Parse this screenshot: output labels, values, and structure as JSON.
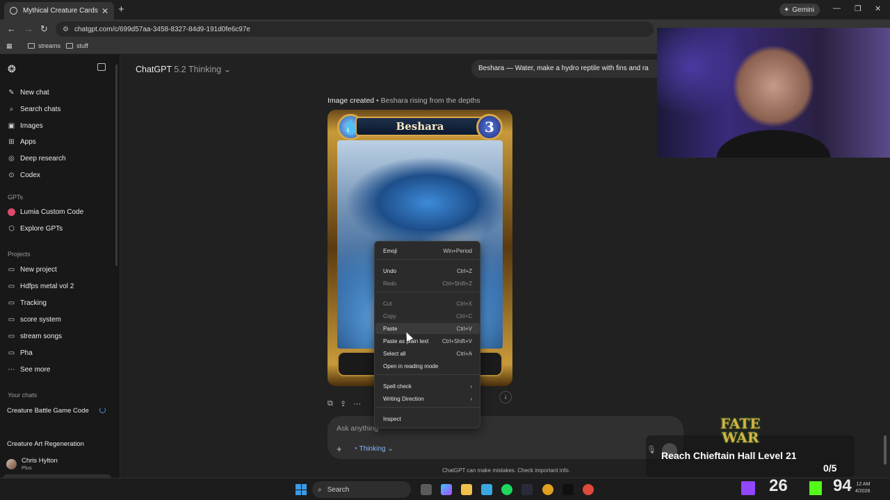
{
  "browser": {
    "tab_title": "Mythical Creature Cards",
    "url": "chatgpt.com/c/699d57aa-3458-8327-84d9-191d0fe6c97e",
    "gemini_label": "Gemini",
    "bookmarks": [
      "streams",
      "stuff"
    ]
  },
  "sidebar": {
    "nav": [
      {
        "label": "New chat",
        "icon": "edit-icon"
      },
      {
        "label": "Search chats",
        "icon": "search-icon"
      },
      {
        "label": "Images",
        "icon": "image-icon"
      },
      {
        "label": "Apps",
        "icon": "grid-icon"
      },
      {
        "label": "Deep research",
        "icon": "telescope-icon"
      },
      {
        "label": "Codex",
        "icon": "code-icon"
      }
    ],
    "gpts_heading": "GPTs",
    "gpts": [
      {
        "label": "Lumia Custom Code"
      },
      {
        "label": "Explore GPTs"
      }
    ],
    "projects_heading": "Projects",
    "projects": [
      "New project",
      "Hdfps metal vol 2",
      "Tracking",
      "score system",
      "stream songs",
      "Pha",
      "See more"
    ],
    "chats_heading": "Your chats",
    "chats": [
      "Creature Battle Game Code",
      "Mythical Creature Cards",
      "Creature Art Regeneration"
    ],
    "user": {
      "name": "Chris Hylton",
      "plan": "Plus"
    }
  },
  "main": {
    "model_name": "ChatGPT",
    "model_version": "5.2 Thinking",
    "user_message": "Beshara — Water, make a hydro reptile with fins and ra",
    "image_caption_bold": "Image created",
    "image_caption": " • Beshara rising from the depths",
    "card": {
      "name": "Beshara",
      "cost": "3",
      "accent": "#d8a84a"
    },
    "composer_placeholder": "Ask anything",
    "composer_mode": "Thinking",
    "disclaimer": "ChatGPT can make mistakes. Check important info."
  },
  "context_menu": {
    "items": [
      {
        "label": "Emoji",
        "shortcut": "Win+Period",
        "disabled": false
      },
      {
        "label": "Undo",
        "shortcut": "Ctrl+Z",
        "disabled": false
      },
      {
        "label": "Redo",
        "shortcut": "Ctrl+Shift+Z",
        "disabled": true
      },
      {
        "label": "Cut",
        "shortcut": "Ctrl+X",
        "disabled": true
      },
      {
        "label": "Copy",
        "shortcut": "Ctrl+C",
        "disabled": true
      },
      {
        "label": "Paste",
        "shortcut": "Ctrl+V",
        "disabled": false
      },
      {
        "label": "Paste as plain text",
        "shortcut": "Ctrl+Shift+V",
        "disabled": false
      },
      {
        "label": "Select all",
        "shortcut": "Ctrl+A",
        "disabled": false
      },
      {
        "label": "Open in reading mode",
        "shortcut": "",
        "disabled": false
      },
      {
        "label": "Spell check",
        "shortcut": "›",
        "disabled": false
      },
      {
        "label": "Writing Direction",
        "shortcut": "›",
        "disabled": false
      },
      {
        "label": "Inspect",
        "shortcut": "",
        "disabled": false
      }
    ]
  },
  "overlay": {
    "logo_top": "FATE",
    "logo_bottom": "WAR",
    "goal_text": "Reach Chieftain Hall Level 21",
    "goal_progress": "0/5",
    "twitch_count": "26",
    "kick_count": "94",
    "clock_time": "12 AM",
    "clock_date": "4/2026"
  },
  "taskbar": {
    "search_label": "Search"
  }
}
